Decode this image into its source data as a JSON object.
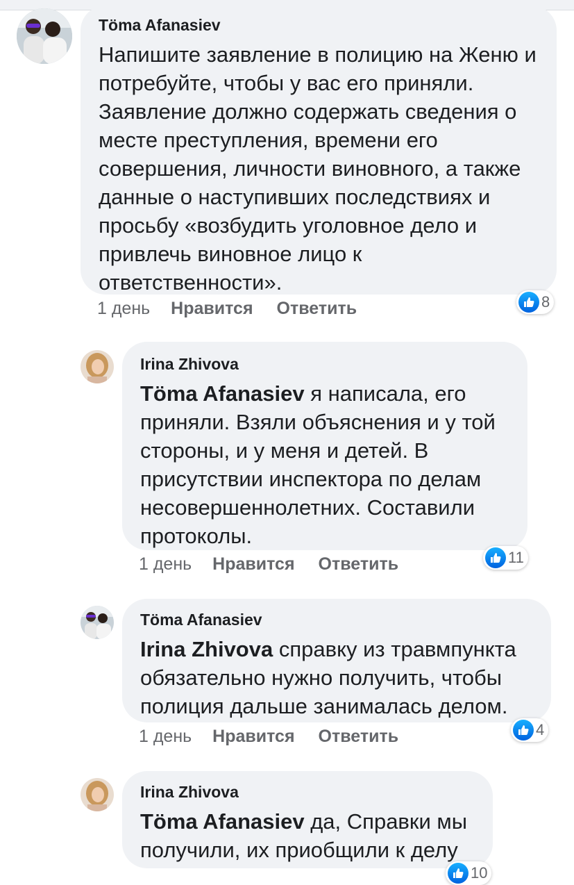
{
  "comments": [
    {
      "author": "Töma Afanasiev",
      "mention": "",
      "text": "Напишите заявление в полицию на Женю и потребуйте, чтобы у вас его приняли. Заявление должно содержать сведения о месте преступления, времени его совершения, личности виновного, а также данные о наступивших последствиях и просьбу «возбудить уголовное дело и привлечь виновное лицо к ответственности».",
      "time": "1 день",
      "like_label": "Нравится",
      "reply_label": "Ответить",
      "reactions": "8"
    },
    {
      "author": "Irina Zhivova",
      "mention": "Töma Afanasiev",
      "text": " я написала, его приняли. Взяли объяснения и у той стороны, и у меня и детей. В присутствии инспектора по делам несовершеннолетних. Составили протоколы.",
      "time": "1 день",
      "like_label": "Нравится",
      "reply_label": "Ответить",
      "reactions": "11"
    },
    {
      "author": "Töma Afanasiev",
      "mention": "Irina Zhivova",
      "text": " справку из травмпункта обязательно нужно получить, чтобы полиция дальше занималась делом.",
      "time": "1 день",
      "like_label": "Нравится",
      "reply_label": "Ответить",
      "reactions": "4"
    },
    {
      "author": "Irina Zhivova",
      "mention": "Töma Afanasiev",
      "text": " да, Справки мы получили, их приобщили к делу",
      "time": "",
      "like_label": "",
      "reply_label": "",
      "reactions": "10"
    }
  ],
  "icons": {
    "reaction": "like-thumbs-up-icon"
  },
  "colors": {
    "bubble": "#f0f2f5",
    "like_blue": "#1877f2",
    "meta_gray": "#65676b"
  }
}
